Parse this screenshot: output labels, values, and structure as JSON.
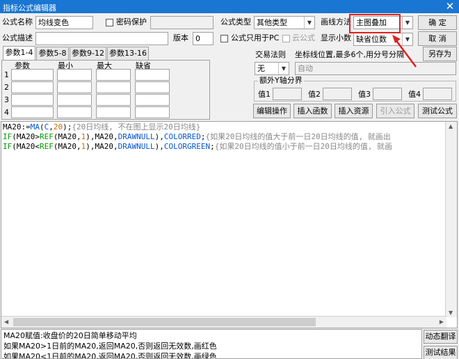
{
  "window": {
    "title": "指标公式编辑器"
  },
  "form": {
    "name_label": "公式名称",
    "name_value": "均线变色",
    "password_label": "密码保护",
    "type_label": "公式类型",
    "type_value": "其他类型",
    "draw_label": "画线方法",
    "draw_value": "主图叠加",
    "desc_label": "公式描述",
    "version_label": "版本",
    "version_value": "0",
    "pc_only_label": "公式只用于PC",
    "cloud_label": "云公式",
    "decimals_label": "显示小数",
    "decimals_value": "缺省位数",
    "trade_rule_label": "交易法则",
    "trade_rule_value": "无",
    "coord_label": "坐标线位置,最多6个,用分号分隔",
    "coord_value": "自动",
    "extra_y_label": "额外Y轴分界",
    "y_labels": [
      "值1",
      "值2",
      "值3",
      "值4"
    ]
  },
  "buttons": {
    "ok": "确  定",
    "cancel": "取  消",
    "save_as": "另存为",
    "edit_op": "编辑操作",
    "insert_fn": "插入函数",
    "insert_res": "插入资源",
    "import_formula": "引入公式",
    "test_formula": "测试公式",
    "dyn_translate": "动态翻译",
    "test_result": "测试结果"
  },
  "param_tabs": [
    "参数1-4",
    "参数5-8",
    "参数9-12",
    "参数13-16"
  ],
  "param_headers": [
    "参数",
    "最小",
    "最大",
    "缺省"
  ],
  "param_rows": [
    "1",
    "2",
    "3",
    "4"
  ],
  "code": {
    "l1": [
      "MA20:=",
      "MA",
      "(",
      "C",
      ",",
      "20",
      ");",
      "{20日均线, 不在图上显示20日均线}"
    ],
    "l2": [
      "IF",
      "(MA20>",
      "REF",
      "(MA20,",
      "1",
      "),MA20,",
      "DRAWNULL",
      "),",
      "COLORRED",
      ";",
      "{如果20日均线的值大于前一日20日均线的值, 就画出"
    ],
    "l3": [
      "IF",
      "(MA20<",
      "REF",
      "(MA20,",
      "1",
      "),MA20,",
      "DRAWNULL",
      "),",
      "COLORGREEN",
      ";",
      "{如果20日均线的值小于前一日20日均线的值, 就画"
    ]
  },
  "explanation": [
    "MA20赋值:收盘价的20日简单移动平均",
    "如果MA20>1日前的MA20,返回MA20,否则返回无效数,画红色",
    "如果MA20<1日前的MA20,返回MA20,否则返回无效数,画绿色"
  ]
}
